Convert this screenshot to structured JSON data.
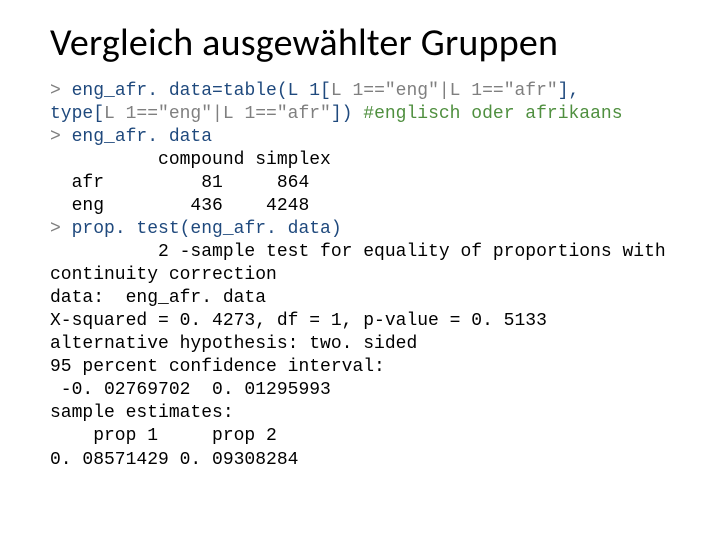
{
  "title": "Vergleich ausgewählter Gruppen",
  "code": {
    "prompt1": "> ",
    "cmd1a": "eng_afr. data=table(L 1[",
    "cmd1b": "L 1==\"eng\"|L 1==\"afr\"",
    "cmd1c": "],",
    "cmd2a": "type[",
    "cmd2b": "L 1==\"eng\"|L 1==\"afr\"",
    "cmd2c": "]) ",
    "comment": "#englisch oder afrikaans",
    "prompt2": "> ",
    "cmd3": "eng_afr. data",
    "header": "          compound simplex",
    "row1": "  afr         81     864",
    "row2": "  eng        436    4248",
    "prompt3": "> ",
    "cmd4": "prop. test(eng_afr. data)",
    "out1": "          2 -sample test for equality of proportions with",
    "out2": "continuity correction",
    "out3": "data:  eng_afr. data",
    "out4": "X-squared = 0. 4273, df = 1, p-value = 0. 5133",
    "out5": "alternative hypothesis: two. sided",
    "out6": "95 percent confidence interval:",
    "out7": " -0. 02769702  0. 01295993",
    "out8": "sample estimates:",
    "out9": "    prop 1     prop 2",
    "out10": "0. 08571429 0. 09308284"
  }
}
